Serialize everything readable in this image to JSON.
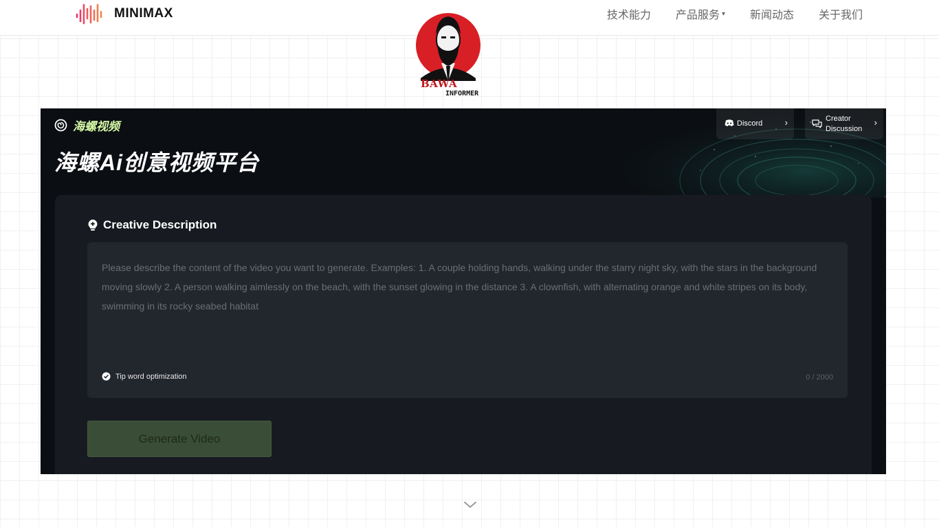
{
  "header": {
    "brand": "MINIMAX",
    "nav": [
      {
        "label": "技术能力"
      },
      {
        "label": "产品服务",
        "has_dropdown": true
      },
      {
        "label": "新闻动态"
      },
      {
        "label": "关于我们"
      }
    ],
    "brand_icon": "soundwave-logo-icon",
    "accent_colors": [
      "#e8336e",
      "#f08a4b"
    ]
  },
  "watermark": {
    "line1": "BAWA",
    "line2": "INFORMER"
  },
  "hero": {
    "brand_name": "海螺视频",
    "title": "海螺Ai创意视频平台",
    "links": [
      {
        "label": "Discord",
        "icon": "discord-icon"
      },
      {
        "label_line1": "Creator",
        "label_line2": "Discussion",
        "icon": "chat-bubbles-icon"
      }
    ]
  },
  "form": {
    "section_title": "Creative Description",
    "section_icon": "lightbulb-plus-icon",
    "prompt_value": "",
    "prompt_placeholder": "Please describe the content of the video you want to generate. Examples: 1. A couple holding hands, walking under the starry night sky, with the stars in the background moving slowly 2. A person walking aimlessly on the beach, with the sunset glowing in the distance 3. A clownfish, with alternating orange and white stripes on its body, swimming in its rocky seabed habitat",
    "tip_label": "Tip word optimization",
    "tip_checked": true,
    "char_count": "0 / 2000",
    "generate_label": "Generate Video"
  },
  "colors": {
    "panel_bg": "#0b0e12",
    "card_bg": "#171b21",
    "brand_green": "#d5f8a6",
    "button_green": "#3a4d36"
  }
}
